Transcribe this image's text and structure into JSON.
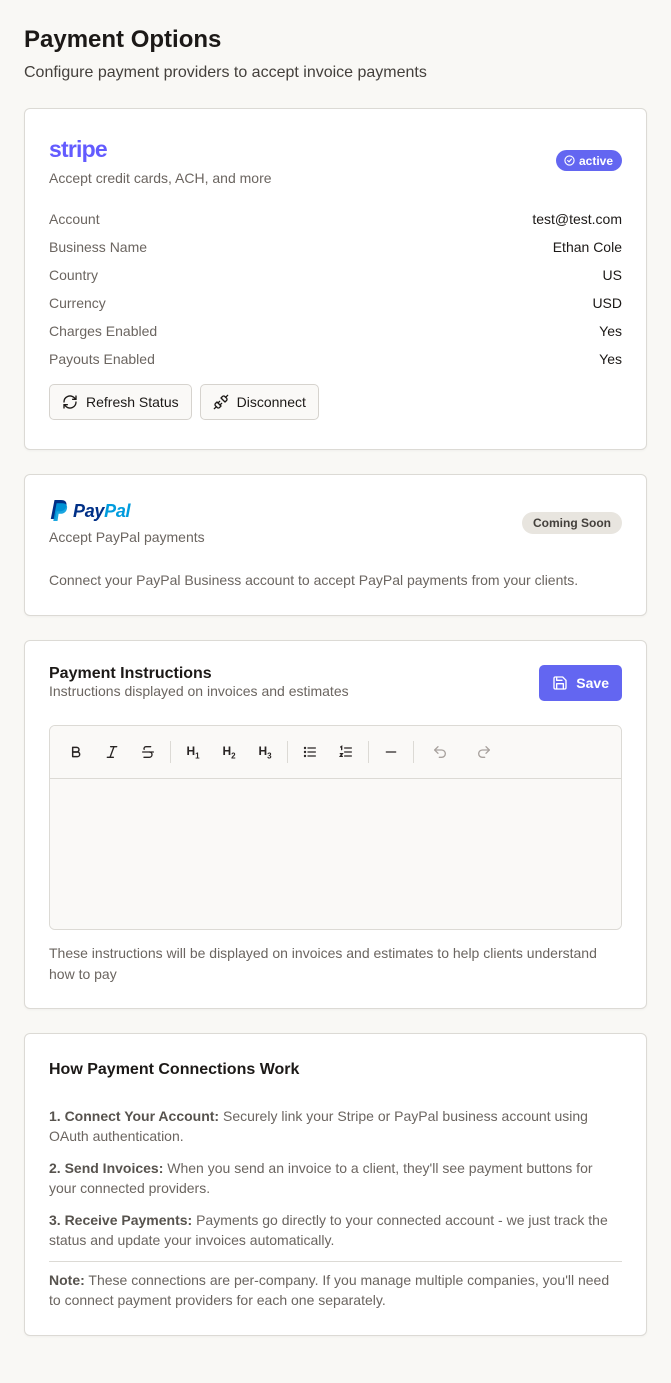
{
  "header": {
    "title": "Payment Options",
    "subtitle": "Configure payment providers to accept invoice payments"
  },
  "stripe": {
    "logo_text": "stripe",
    "description": "Accept credit cards, ACH, and more",
    "status": "active",
    "details": [
      {
        "label": "Account",
        "value": "test@test.com"
      },
      {
        "label": "Business Name",
        "value": "Ethan Cole"
      },
      {
        "label": "Country",
        "value": "US"
      },
      {
        "label": "Currency",
        "value": "USD"
      },
      {
        "label": "Charges Enabled",
        "value": "Yes"
      },
      {
        "label": "Payouts Enabled",
        "value": "Yes"
      }
    ],
    "refresh_label": "Refresh Status",
    "disconnect_label": "Disconnect",
    "brand_color": "#635bff"
  },
  "paypal": {
    "logo_pay": "Pay",
    "logo_pal": "Pal",
    "description": "Accept PayPal payments",
    "badge": "Coming Soon",
    "info": "Connect your PayPal Business account to accept PayPal payments from your clients."
  },
  "instructions": {
    "title": "Payment Instructions",
    "subtitle": "Instructions displayed on invoices and estimates",
    "save_label": "Save",
    "toolbar": [
      "bold-icon",
      "italic-icon",
      "strikethrough-icon",
      "heading-1-icon",
      "heading-2-icon",
      "heading-3-icon",
      "bullet-list-icon",
      "ordered-list-icon",
      "horizontal-rule-icon",
      "undo-icon",
      "redo-icon"
    ],
    "h1": "H",
    "h2": "H",
    "h3": "H",
    "editor_value": "",
    "help": "These instructions will be displayed on invoices and estimates to help clients understand how to pay"
  },
  "how": {
    "title": "How Payment Connections Work",
    "steps": [
      {
        "lead": "1. Connect Your Account:",
        "text": " Securely link your Stripe or PayPal business account using OAuth authentication."
      },
      {
        "lead": "2. Send Invoices:",
        "text": " When you send an invoice to a client, they'll see payment buttons for your connected providers."
      },
      {
        "lead": "3. Receive Payments:",
        "text": " Payments go directly to your connected account - we just track the status and update your invoices automatically."
      }
    ],
    "note_lead": "Note:",
    "note_text": " These connections are per-company. If you manage multiple companies, you'll need to connect payment providers for each one separately."
  },
  "colors": {
    "accent": "#6366f1",
    "background": "#f9f8f5"
  }
}
